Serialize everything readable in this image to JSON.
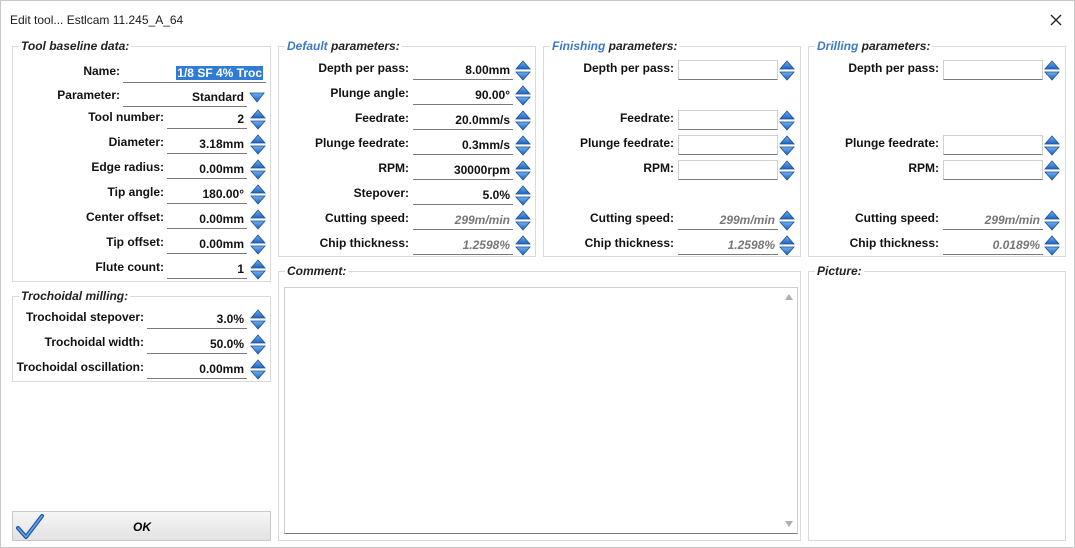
{
  "window": {
    "title": "Edit tool... Estlcam 11.245_A_64"
  },
  "baseline": {
    "legend": "Tool baseline data:",
    "name_label": "Name:",
    "name_value": "1/8 SF 4% Troc",
    "parameter_label": "Parameter:",
    "parameter_value": "Standard",
    "tool_number_label": "Tool number:",
    "tool_number_value": "2",
    "diameter_label": "Diameter:",
    "diameter_value": "3.18mm",
    "edge_radius_label": "Edge radius:",
    "edge_radius_value": "0.00mm",
    "tip_angle_label": "Tip angle:",
    "tip_angle_value": "180.00°",
    "center_offset_label": "Center offset:",
    "center_offset_value": "0.00mm",
    "tip_offset_label": "Tip offset:",
    "tip_offset_value": "0.00mm",
    "flute_count_label": "Flute count:",
    "flute_count_value": "1"
  },
  "trochoidal": {
    "legend": "Trochoidal  milling:",
    "stepover_label": "Trochoidal stepover:",
    "stepover_value": "3.0%",
    "width_label": "Trochoidal width:",
    "width_value": "50.0%",
    "oscillation_label": "Trochoidal oscillation:",
    "oscillation_value": "0.00mm"
  },
  "default": {
    "legend_hl": "Default",
    "legend_rest": " parameters:",
    "depth_label": "Depth per pass:",
    "depth_value": "8.00mm",
    "plunge_angle_label": "Plunge angle:",
    "plunge_angle_value": "90.00°",
    "feedrate_label": "Feedrate:",
    "feedrate_value": "20.0mm/s",
    "plunge_feedrate_label": "Plunge feedrate:",
    "plunge_feedrate_value": "0.3mm/s",
    "rpm_label": "RPM:",
    "rpm_value": "30000rpm",
    "stepover_label": "Stepover:",
    "stepover_value": "5.0%",
    "cutting_speed_label": "Cutting speed:",
    "cutting_speed_value": "299m/min",
    "chip_label": "Chip thickness:",
    "chip_value": "1.2598%"
  },
  "finishing": {
    "legend_hl": "Finishing",
    "legend_rest": "  parameters:",
    "depth_label": "Depth per pass:",
    "feedrate_label": "Feedrate:",
    "plunge_feedrate_label": "Plunge feedrate:",
    "rpm_label": "RPM:",
    "cutting_speed_label": "Cutting speed:",
    "cutting_speed_value": "299m/min",
    "chip_label": "Chip thickness:",
    "chip_value": "1.2598%"
  },
  "drilling": {
    "legend_hl": "Drilling",
    "legend_rest": "  parameters:",
    "depth_label": "Depth per pass:",
    "plunge_feedrate_label": "Plunge feedrate:",
    "rpm_label": "RPM:",
    "cutting_speed_label": "Cutting speed:",
    "cutting_speed_value": "299m/min",
    "chip_label": "Chip thickness:",
    "chip_value": "0.0189%"
  },
  "comment": {
    "legend": "Comment:"
  },
  "picture": {
    "legend": "Picture:"
  },
  "ok_button": {
    "label": "OK"
  },
  "colors": {
    "spin_blue": "#2f7bd6",
    "legend_blue": "#3f78c9",
    "selection": "#2f7bd6"
  }
}
